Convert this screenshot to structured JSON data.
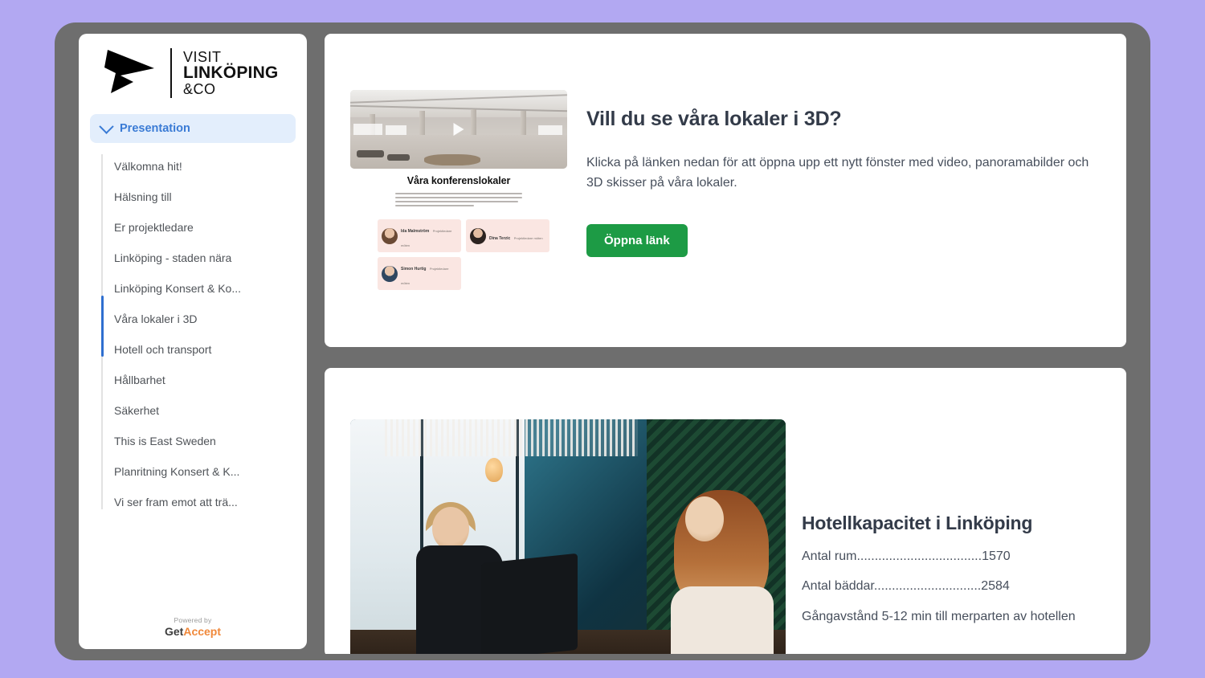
{
  "theme": {
    "page_background": "#b2a8f2",
    "device_frame": "#6e6e6e",
    "accent_blue": "#3a7bd5",
    "accent_green": "#1d9b45",
    "heading_color": "#333b49",
    "body_color": "#474f5c",
    "getaccept_orange": "#f0883a"
  },
  "sidebar": {
    "logo": {
      "line1": "VISIT",
      "line2": "LINKÖPING",
      "line3": "&CO",
      "mark": "arrow-logo-icon"
    },
    "section": {
      "label": "Presentation",
      "chevron": "chevron-down-icon",
      "expanded": true
    },
    "items": [
      {
        "label": "Välkomna hit!",
        "active": false
      },
      {
        "label": "Hälsning till",
        "active": false
      },
      {
        "label": "Er projektledare",
        "active": false
      },
      {
        "label": "Linköping - staden nära",
        "active": false
      },
      {
        "label": "Linköping Konsert & Ko...",
        "active": false
      },
      {
        "label": "Våra lokaler i 3D",
        "active": true
      },
      {
        "label": "Hotell och transport",
        "active": true
      },
      {
        "label": "Hållbarhet",
        "active": false
      },
      {
        "label": "Säkerhet",
        "active": false
      },
      {
        "label": "This is East Sweden",
        "active": false
      },
      {
        "label": "Planritning Konsert & K...",
        "active": false
      },
      {
        "label": "Vi ser fram emot att trä...",
        "active": false
      }
    ],
    "footer": {
      "powered_by": "Powered by",
      "brand_first": "Get",
      "brand_second": "Accept"
    }
  },
  "main": {
    "cards": {
      "three_d": {
        "heading": "Vill du se våra lokaler i 3D?",
        "paragraph": "Klicka på länken nedan för att öppna upp ett nytt fönster med video, panoramabilder och 3D skisser på våra lokaler.",
        "button_label": "Öppna länk",
        "thumbnail": {
          "play_icon": "play-triangle-icon",
          "title": "Våra konferenslokaler",
          "contacts": [
            {
              "name": "Ida Malmström",
              "role": "Projektledare möten"
            },
            {
              "name": "Dina Terzic",
              "role": "Projektledare möten"
            },
            {
              "name": "Simon Hurtig",
              "role": "Projektledare möten"
            }
          ]
        }
      },
      "hotel": {
        "heading": "Hotellkapacitet i Linköping",
        "stats": [
          {
            "label": "Antal rum",
            "dots": "...................................",
            "value": "1570"
          },
          {
            "label": "Antal bäddar",
            "dots": "..............................",
            "value": "2584"
          }
        ],
        "note": "Gångavstånd 5-12 min till merparten av hotellen",
        "photo_alt": "hotel-reception-photo"
      }
    }
  }
}
